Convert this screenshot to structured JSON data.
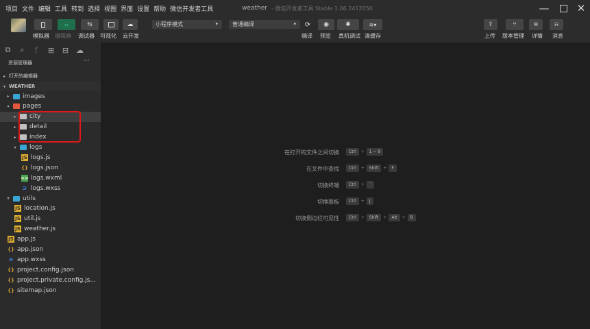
{
  "menubar": {
    "items": [
      "项目",
      "文件",
      "编辑",
      "工具",
      "转到",
      "选择",
      "视图",
      "界面",
      "设置",
      "帮助",
      "微信开发者工具"
    ],
    "project_name": "weather",
    "app_name": "- 微信开发者工具 Stable 1.06.2412050"
  },
  "toolbar": {
    "labels": {
      "simulator": "模拟器",
      "editor": "编辑器",
      "debugger": "调试器",
      "visual": "可视化",
      "cloud": "云开发",
      "compile": "编译",
      "preview": "预览",
      "remote_debug": "真机调试",
      "clear_cache": "清缓存",
      "upload": "上传",
      "version": "版本管理",
      "details": "详情",
      "messages": "消息"
    },
    "mode_select": "小程序模式",
    "compile_select": "普通编译"
  },
  "sidebar": {
    "title": "资源管理器",
    "more": "···",
    "open_editors": "打开的编辑器",
    "project": "WEATHER",
    "tree": [
      {
        "label": "images",
        "type": "folder-special",
        "depth": 1,
        "arrow": "▸"
      },
      {
        "label": "pages",
        "type": "folder-special",
        "depth": 1,
        "arrow": "▾"
      },
      {
        "label": "city",
        "type": "folder",
        "depth": 2,
        "arrow": "▸"
      },
      {
        "label": "detail",
        "type": "folder",
        "depth": 2,
        "arrow": "▸"
      },
      {
        "label": "index",
        "type": "folder",
        "depth": 2,
        "arrow": "▸"
      },
      {
        "label": "logs",
        "type": "folder-special",
        "depth": 2,
        "arrow": "▾"
      },
      {
        "label": "logs.js",
        "type": "js",
        "depth": 3,
        "arrow": ""
      },
      {
        "label": "logs.json",
        "type": "json",
        "depth": 3,
        "arrow": ""
      },
      {
        "label": "logs.wxml",
        "type": "wxml",
        "depth": 3,
        "arrow": ""
      },
      {
        "label": "logs.wxss",
        "type": "wxss",
        "depth": 3,
        "arrow": ""
      },
      {
        "label": "utils",
        "type": "folder-special",
        "depth": 1,
        "arrow": "▾"
      },
      {
        "label": "location.js",
        "type": "js",
        "depth": 2,
        "arrow": ""
      },
      {
        "label": "util.js",
        "type": "js",
        "depth": 2,
        "arrow": ""
      },
      {
        "label": "weather.js",
        "type": "js",
        "depth": 2,
        "arrow": ""
      },
      {
        "label": "app.js",
        "type": "js",
        "depth": 1,
        "arrow": ""
      },
      {
        "label": "app.json",
        "type": "json",
        "depth": 1,
        "arrow": ""
      },
      {
        "label": "app.wxss",
        "type": "wxss",
        "depth": 1,
        "arrow": ""
      },
      {
        "label": "project.config.json",
        "type": "json",
        "depth": 1,
        "arrow": ""
      },
      {
        "label": "project.private.config.js...",
        "type": "json",
        "depth": 1,
        "arrow": ""
      },
      {
        "label": "sitemap.json",
        "type": "json",
        "depth": 1,
        "arrow": ""
      }
    ]
  },
  "shortcuts": [
    {
      "label": "在打开的文件之间切换",
      "keys": [
        "Ctrl",
        "1 ~ 9"
      ]
    },
    {
      "label": "在文件中查找",
      "keys": [
        "Ctrl",
        "Shift",
        "F"
      ]
    },
    {
      "label": "切换终端",
      "keys": [
        "Ctrl",
        "`"
      ]
    },
    {
      "label": "切换面板",
      "keys": [
        "Ctrl",
        "J"
      ]
    },
    {
      "label": "切换侧边栏可见性",
      "keys": [
        "Ctrl",
        "Shift",
        "Alt",
        "B"
      ]
    }
  ],
  "colors": {
    "accent_green": "#1f6f4c",
    "highlight_red": "#e01818",
    "folder_special": "#3aa6d6",
    "folder_pages": "#e4583e",
    "folder_plain": "#c0c0c0"
  }
}
